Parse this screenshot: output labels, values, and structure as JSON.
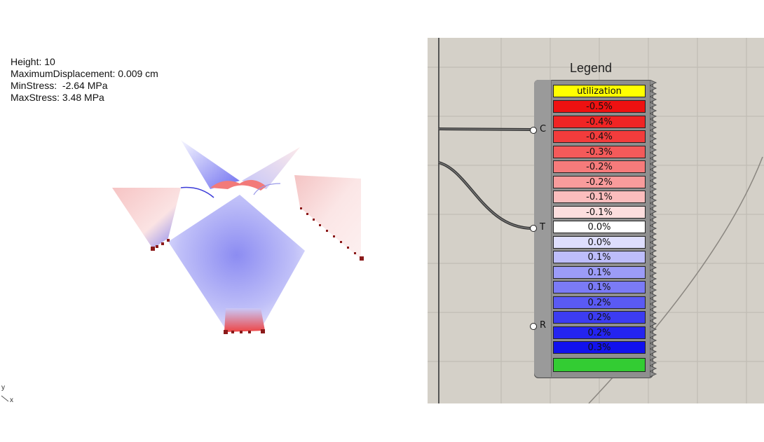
{
  "viewport": {
    "info": {
      "height": "Height: 10",
      "max_displacement": "MaximumDisplacement: 0.009 cm",
      "min_stress": "MinStress:  -2.64 MPa",
      "max_stress": "MaxStress: 3.48 MPa"
    },
    "axes": {
      "y": "y",
      "x": "x"
    }
  },
  "legend": {
    "title": "Legend",
    "inputs": [
      "C",
      "T",
      "R"
    ],
    "header": "utilization",
    "header_color": "#ffff00",
    "rows": [
      {
        "label": "-0.5%",
        "color": "#ee1111"
      },
      {
        "label": "-0.4%",
        "color": "#f02424"
      },
      {
        "label": "-0.4%",
        "color": "#f23c3c"
      },
      {
        "label": "-0.3%",
        "color": "#f45a5a"
      },
      {
        "label": "-0.2%",
        "color": "#f67b7b"
      },
      {
        "label": "-0.2%",
        "color": "#f89c9c"
      },
      {
        "label": "-0.1%",
        "color": "#fbbdbd"
      },
      {
        "label": "-0.1%",
        "color": "#fddede"
      },
      {
        "label": "0.0%",
        "color": "#ffffff"
      },
      {
        "label": "0.0%",
        "color": "#dedefd"
      },
      {
        "label": "0.1%",
        "color": "#bdbdfb"
      },
      {
        "label": "0.1%",
        "color": "#9c9cf8"
      },
      {
        "label": "0.1%",
        "color": "#7b7bf6"
      },
      {
        "label": "0.2%",
        "color": "#5a5af4"
      },
      {
        "label": "0.2%",
        "color": "#3c3cf2"
      },
      {
        "label": "0.2%",
        "color": "#2424f0"
      },
      {
        "label": "0.3%",
        "color": "#1111ee"
      }
    ],
    "footer_color": "#33cc33"
  }
}
